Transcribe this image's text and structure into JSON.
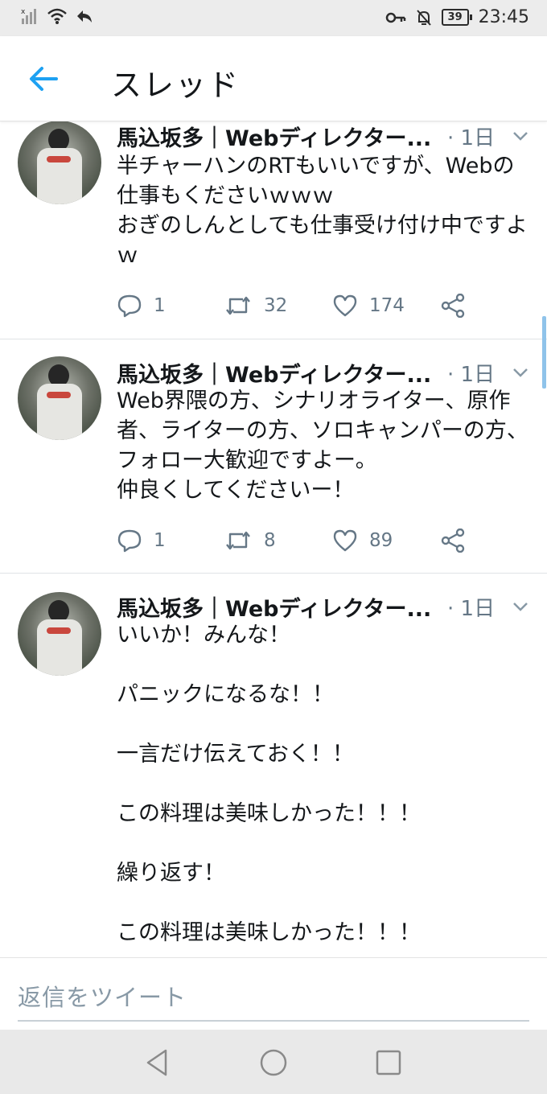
{
  "status_bar": {
    "battery": "39",
    "time": "23:45",
    "icons": [
      "signal-icon",
      "wifi-icon",
      "reply-arrow-icon",
      "key-icon",
      "bell-off-icon",
      "battery-icon"
    ]
  },
  "header": {
    "title": "スレッド",
    "back_icon": "arrow-left-icon",
    "accent_color": "#1da1f2"
  },
  "tweets": [
    {
      "name": "馬込坂多｜Webディレクター...",
      "time": "· 1日",
      "text": "半チャーハンのRTもいいですが、Webの仕事もくださいｗｗｗ\nおぎのしんとしても仕事受け付け中ですよｗ",
      "replies": "1",
      "retweets": "32",
      "likes": "174"
    },
    {
      "name": "馬込坂多｜Webディレクター...",
      "time": "· 1日",
      "text": "Web界隈の方、シナリオライター、原作者、ライターの方、ソロキャンパーの方、フォロー大歓迎ですよー。\n仲良くしてくださいー！",
      "replies": "1",
      "retweets": "8",
      "likes": "89"
    },
    {
      "name": "馬込坂多｜Webディレクター...",
      "time": "· 1日",
      "text": "いいか！みんな！\n\nパニックになるな！！\n\n一言だけ伝えておく！！\n\nこの料理は美味しかった！！！\n\n繰り返す！\n\nこの料理は美味しかった！！！"
    }
  ],
  "reply_bar": {
    "placeholder": "返信をツイート"
  },
  "nav_bar": {
    "icons": [
      "back-triangle-icon",
      "home-circle-icon",
      "recents-square-icon"
    ]
  }
}
